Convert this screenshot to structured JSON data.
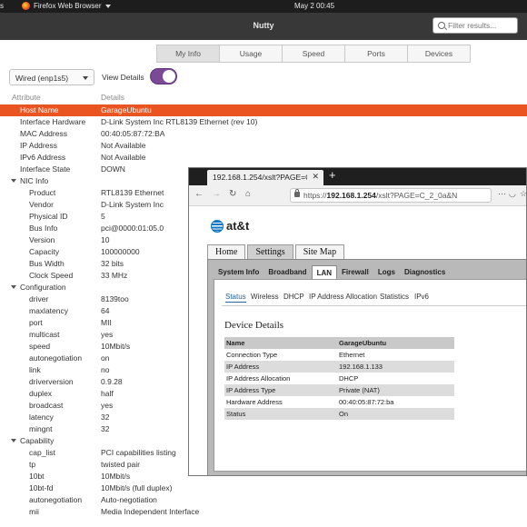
{
  "topbar": {
    "activities": "s",
    "app_name": "Firefox Web Browser",
    "clock": "May 2  00:45"
  },
  "window": {
    "title": "Nutty",
    "filter_placeholder": "Filter results..."
  },
  "tabs": [
    "My Info",
    "Usage",
    "Speed",
    "Ports",
    "Devices"
  ],
  "active_tab": "My Info",
  "interface_select": "Wired (enp1s5)",
  "view_details_label": "View Details",
  "view_details_on": true,
  "headers": {
    "attribute": "Attribute",
    "details": "Details"
  },
  "tree": [
    {
      "k": "Host Name",
      "v": "GarageUbuntu",
      "level": 1,
      "selected": true
    },
    {
      "k": "Interface Hardware",
      "v": "D-Link System Inc RTL8139 Ethernet (rev 10)",
      "level": 1
    },
    {
      "k": "MAC Address",
      "v": "00:40:05:87:72:BA",
      "level": 1
    },
    {
      "k": "IP Address",
      "v": "Not Available",
      "level": 1
    },
    {
      "k": "IPv6 Address",
      "v": "Not Available",
      "level": 1
    },
    {
      "k": "Interface State",
      "v": "DOWN",
      "level": 1
    },
    {
      "k": "NIC Info",
      "v": "",
      "level": 0
    },
    {
      "k": "Product",
      "v": "RTL8139 Ethernet",
      "level": 2
    },
    {
      "k": "Vendor",
      "v": "D-Link System Inc",
      "level": 2
    },
    {
      "k": "Physical ID",
      "v": "5",
      "level": 2
    },
    {
      "k": "Bus Info",
      "v": "pci@0000:01:05.0",
      "level": 2
    },
    {
      "k": "Version",
      "v": "10",
      "level": 2
    },
    {
      "k": "Capacity",
      "v": "100000000",
      "level": 2
    },
    {
      "k": "Bus Width",
      "v": "32 bits",
      "level": 2
    },
    {
      "k": "Clock Speed",
      "v": "33 MHz",
      "level": 2
    },
    {
      "k": "Configuration",
      "v": "",
      "level": 0
    },
    {
      "k": "driver",
      "v": "8139too",
      "level": 2
    },
    {
      "k": "maxlatency",
      "v": "64",
      "level": 2
    },
    {
      "k": "port",
      "v": "MII",
      "level": 2
    },
    {
      "k": "multicast",
      "v": "yes",
      "level": 2
    },
    {
      "k": "speed",
      "v": "10Mbit/s",
      "level": 2
    },
    {
      "k": "autonegotiation",
      "v": "on",
      "level": 2
    },
    {
      "k": "link",
      "v": "no",
      "level": 2
    },
    {
      "k": "driverversion",
      "v": "0.9.28",
      "level": 2
    },
    {
      "k": "duplex",
      "v": "half",
      "level": 2
    },
    {
      "k": "broadcast",
      "v": "yes",
      "level": 2
    },
    {
      "k": "latency",
      "v": "32",
      "level": 2
    },
    {
      "k": "mingnt",
      "v": "32",
      "level": 2
    },
    {
      "k": "Capability",
      "v": "",
      "level": 0
    },
    {
      "k": "cap_list",
      "v": "PCI capabilities listing",
      "level": 2
    },
    {
      "k": "tp",
      "v": "twisted pair",
      "level": 2
    },
    {
      "k": "10bt",
      "v": "10Mbit/s",
      "level": 2
    },
    {
      "k": "10bt-fd",
      "v": "10Mbit/s (full duplex)",
      "level": 2
    },
    {
      "k": "autonegotiation",
      "v": "Auto-negotiation",
      "level": 2
    },
    {
      "k": "mii",
      "v": "Media Independent Interface",
      "level": 2
    }
  ],
  "browser": {
    "tab_title": "192.168.1.254/xslt?PAGE=C",
    "new_tab": "+",
    "url_prefix": "https://",
    "url_host": "192.168.1.254",
    "url_path": "/xslt?PAGE=C_2_0a&N",
    "logo_text": "at&t",
    "top_tabs": [
      "Home",
      "Settings",
      "Site Map"
    ],
    "active_top_tab": "Settings",
    "sub_tabs": [
      "System Info",
      "Broadband",
      "LAN",
      "Firewall",
      "Logs",
      "Diagnostics"
    ],
    "active_sub_tab": "LAN",
    "lan_links": [
      "Status",
      "Wireless",
      "DHCP",
      "IP Address Allocation",
      "Statistics",
      "IPv6"
    ],
    "active_lan_link": "Status",
    "section_title": "Device Details",
    "details": [
      [
        "Name",
        "GarageUbuntu"
      ],
      [
        "Connection Type",
        "Ethernet"
      ],
      [
        "IP Address",
        "192.168.1.133"
      ],
      [
        "IP Address Allocation",
        "DHCP"
      ],
      [
        "IP Address Type",
        "Private (NAT)"
      ],
      [
        "Hardware Address",
        "00:40:05:87:72:ba"
      ],
      [
        "Status",
        "On"
      ]
    ]
  }
}
